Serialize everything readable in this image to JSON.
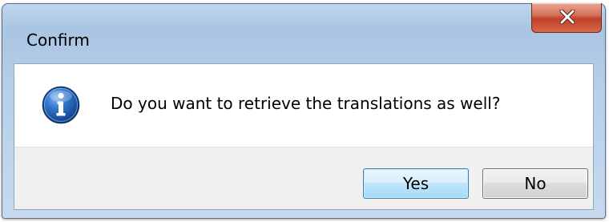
{
  "dialog": {
    "title": "Confirm",
    "message": "Do you want to retrieve the translations as well?",
    "icon": "info-icon",
    "buttons": {
      "yes_label": "Yes",
      "no_label": "No"
    },
    "close_icon": "close-icon"
  },
  "colors": {
    "close_button": "#c2412a",
    "default_button_border": "#3c7fb1",
    "info_icon": "#1f5fb0"
  }
}
